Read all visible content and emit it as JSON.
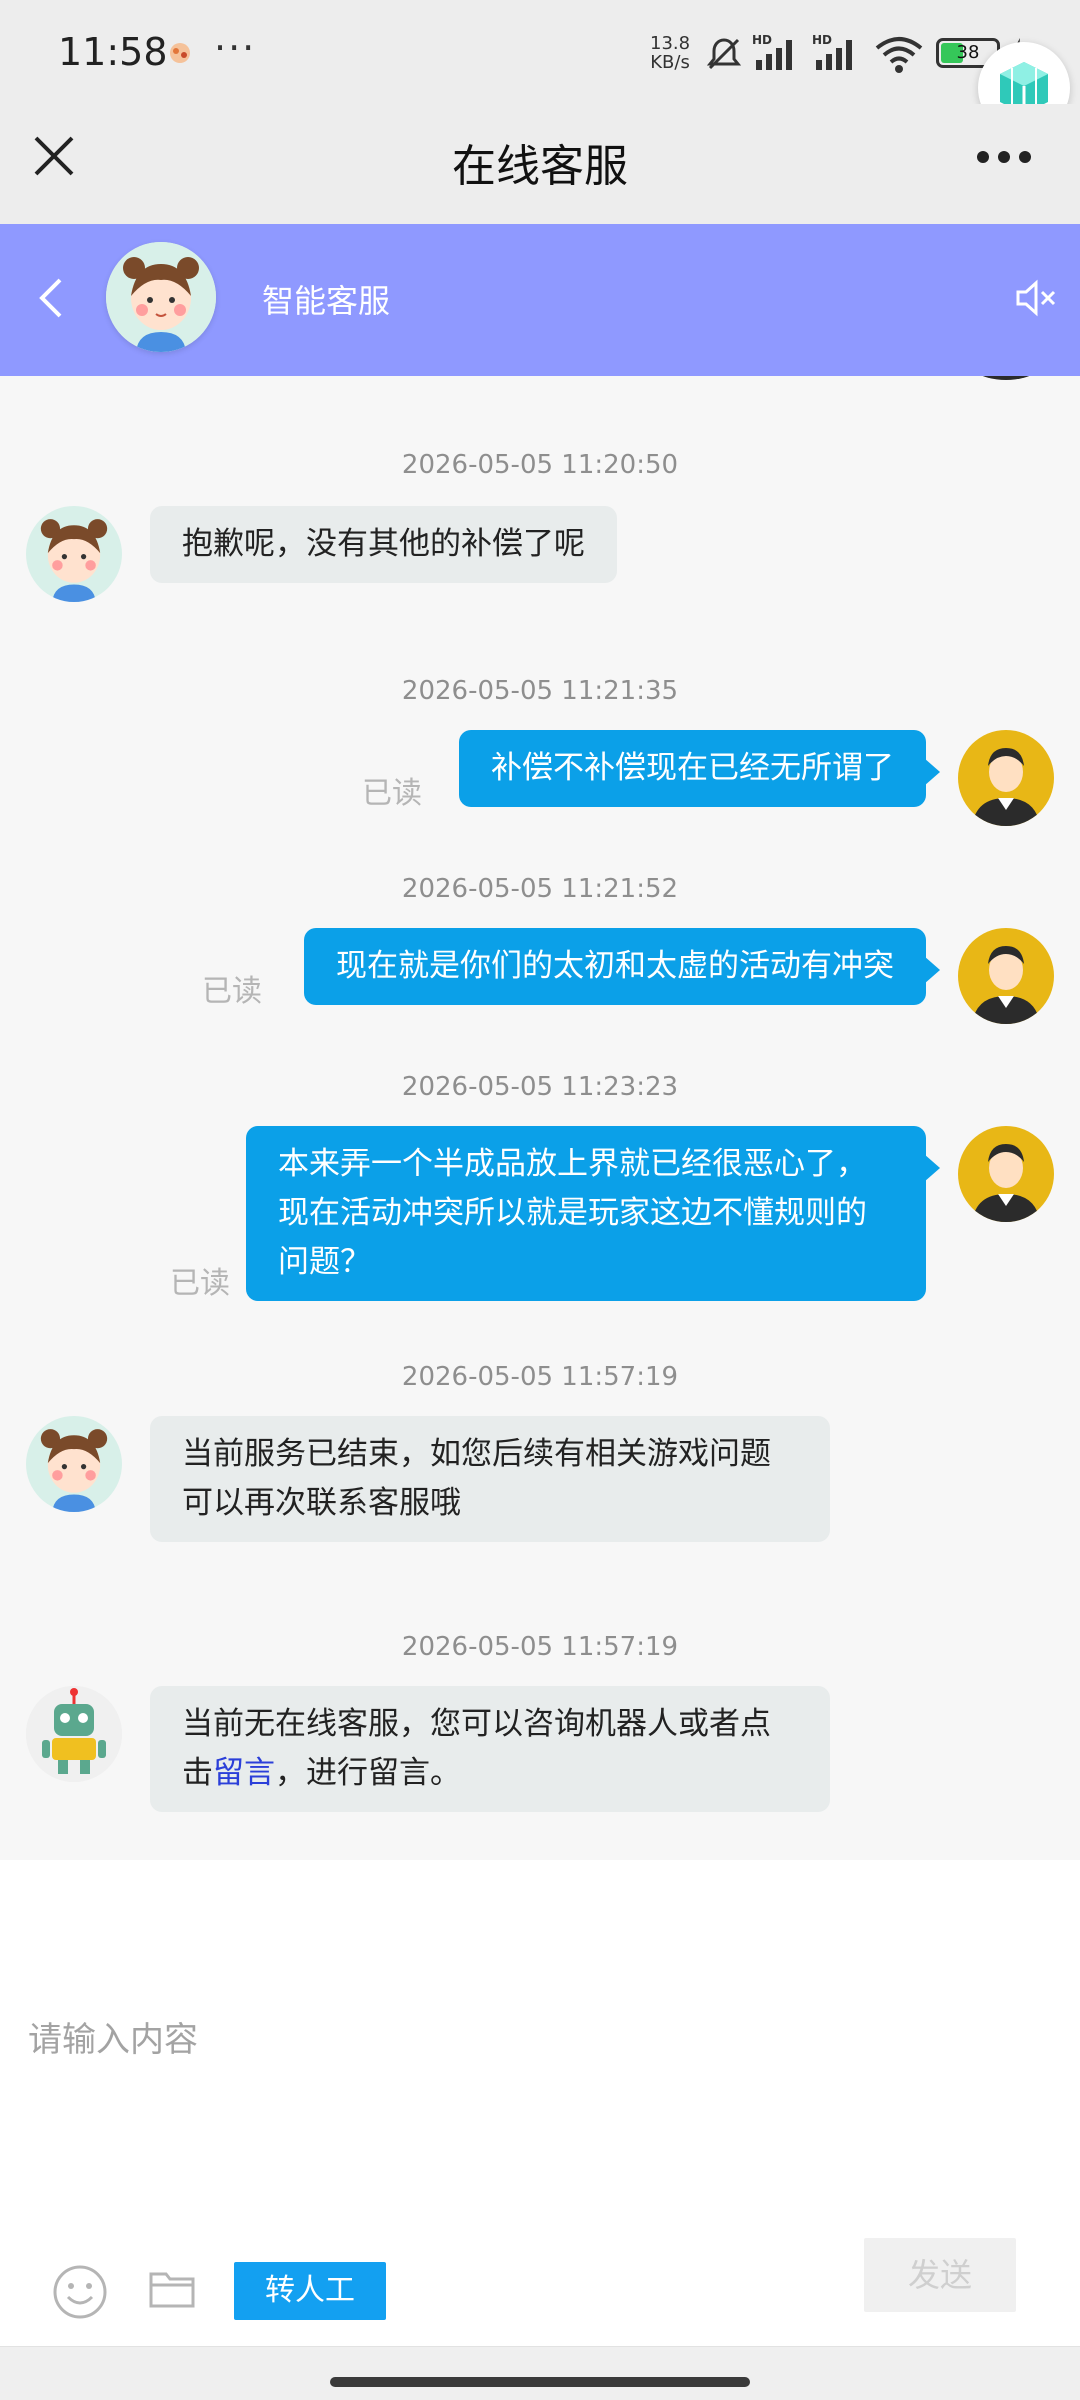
{
  "status_bar": {
    "time": "11:58",
    "more_dots": "···",
    "net_speed_value": "13.8",
    "net_speed_unit": "KB/s",
    "battery_level": "38",
    "icons": [
      "mute-bell-icon",
      "hd-signal-icon",
      "hd-signal-icon",
      "wifi-icon",
      "battery-icon",
      "charging-icon"
    ]
  },
  "nav": {
    "title": "在线客服",
    "close_icon": "close-icon",
    "more_icon": "more-icon"
  },
  "agent": {
    "name": "智能客服",
    "back_icon": "chevron-left-icon",
    "mute_icon": "speaker-mute-icon"
  },
  "messages": [
    {
      "timestamp": "2026-05-05 11:20:50",
      "side": "left",
      "avatar": "girl-avatar",
      "text": "抱歉呢，没有其他的补偿了呢"
    },
    {
      "timestamp": "2026-05-05 11:21:35",
      "side": "right",
      "avatar": "user-avatar",
      "read": "已读",
      "text": "补偿不补偿现在已经无所谓了"
    },
    {
      "timestamp": "2026-05-05 11:21:52",
      "side": "right",
      "avatar": "user-avatar",
      "read": "已读",
      "text": "现在就是你们的太初和太虚的活动有冲突"
    },
    {
      "timestamp": "2026-05-05 11:23:23",
      "side": "right",
      "avatar": "user-avatar",
      "read": "已读",
      "lines": [
        "本来弄一个半成品放上界就已经很恶心了，",
        "现在活动冲突所以就是玩家这边不懂规则的",
        "问题？"
      ]
    },
    {
      "timestamp": "2026-05-05 11:57:19",
      "side": "left",
      "avatar": "girl-avatar",
      "lines": [
        "当前服务已结束，如您后续有相关游戏问题",
        "可以再次联系客服哦"
      ]
    },
    {
      "timestamp": "2026-05-05 11:57:19",
      "side": "left",
      "avatar": "robot-avatar",
      "line1": "当前无在线客服，您可以咨询机器人或者点",
      "line2_prefix": "击",
      "link": "留言",
      "line2_suffix": "，进行留言。"
    }
  ],
  "input": {
    "placeholder": "请输入内容",
    "value": "",
    "emoji_icon": "emoji-icon",
    "folder_icon": "folder-icon",
    "transfer_label": "转人工",
    "send_label": "发送"
  },
  "colors": {
    "agent_header_bg": "#8f99ff",
    "user_bubble": "#0ba0e8",
    "agent_bubble": "#e8ecec",
    "transfer_button": "#13a0f1",
    "link": "#2b3fd9"
  }
}
